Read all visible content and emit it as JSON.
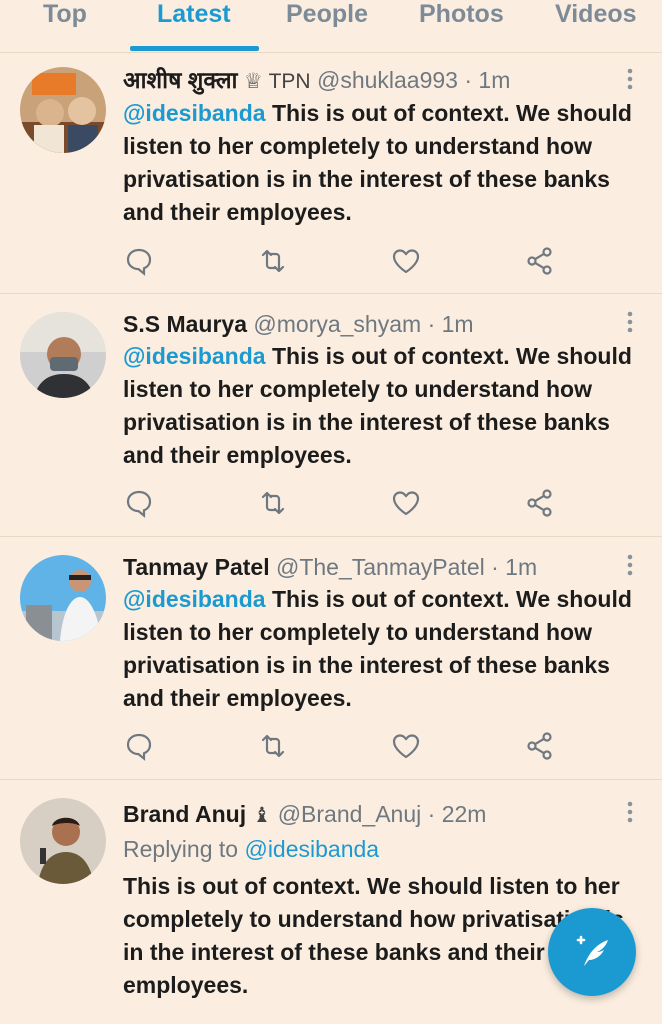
{
  "tabs": [
    "Top",
    "Latest",
    "People",
    "Photos",
    "Videos"
  ],
  "active_tab": "Latest",
  "colors": {
    "accent": "#1b9ad2",
    "background": "#fbeee0",
    "muted": "#6f7880"
  },
  "tweets": [
    {
      "name": "आशीष शुक्ला",
      "badge": "♕ TPN",
      "handle": "@shuklaa993",
      "time": "1m",
      "mention": "@idesibanda",
      "text": "This is out of context. We should listen to her completely to understand how privatisation is in the interest of these banks and their employees."
    },
    {
      "name": "S.S Maurya",
      "badge": "",
      "handle": "@morya_shyam",
      "time": "1m",
      "mention": "@idesibanda",
      "text": "This is out of context. We should listen to her completely to understand how privatisation is in the interest of these banks and their employees."
    },
    {
      "name": "Tanmay Patel",
      "badge": "",
      "handle": "@The_TanmayPatel",
      "time": "1m",
      "mention": "@idesibanda",
      "text": "This is out of context. We should listen to her completely to understand how privatisation is in the interest of these banks and their employees."
    },
    {
      "name": "Brand Anuj",
      "badge": "♝",
      "handle": "@Brand_Anuj",
      "time": "22m",
      "reply_prefix": "Replying to",
      "reply_to": "@idesibanda",
      "text": "This is out of context. We should listen to her completely to understand how privatisation is in the interest of these banks and their employees."
    }
  ],
  "separator": "·",
  "icons": [
    "reply-icon",
    "retweet-icon",
    "like-icon",
    "share-icon",
    "more-vertical-icon",
    "compose-tweet-icon"
  ]
}
